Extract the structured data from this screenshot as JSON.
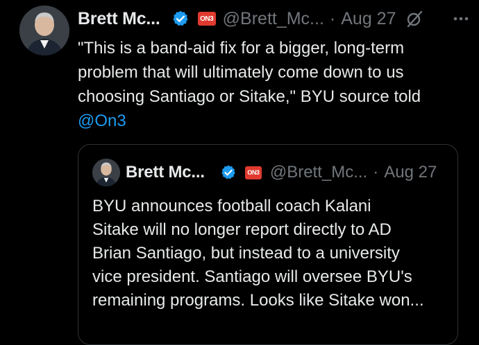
{
  "tweet": {
    "author_name": "Brett Mc...",
    "handle": "@Brett_Mc...",
    "separator": "·",
    "date": "Aug 27",
    "avatar_icon": "profile-photo",
    "verified_icon": "verified-badge-icon",
    "affiliate_badge": "ON3",
    "grok_icon": "grok-icon",
    "more_icon": "more-icon",
    "text_lines": [
      "\"This is a band-aid fix for a bigger, long-term",
      "problem that will ultimately come down to us",
      "choosing Santiago or Sitake,\" BYU source told"
    ],
    "mention": "@On3"
  },
  "quote": {
    "author_name": "Brett Mc...",
    "handle": "@Brett_Mc...",
    "separator": "·",
    "date": "Aug 27",
    "affiliate_badge": "ON3",
    "text_lines": [
      "BYU announces football coach Kalani",
      "Sitake will no longer report directly to AD",
      "Brian Santiago, but instead to a university",
      "vice president. Santiago will oversee BYU's",
      "remaining programs. Looks like Sitake won..."
    ]
  },
  "colors": {
    "background": "#000000",
    "text": "#e7e9ea",
    "muted": "#71767b",
    "accent": "#1d9bf0",
    "border": "#2f3336",
    "on3_red": "#e03a2f"
  }
}
